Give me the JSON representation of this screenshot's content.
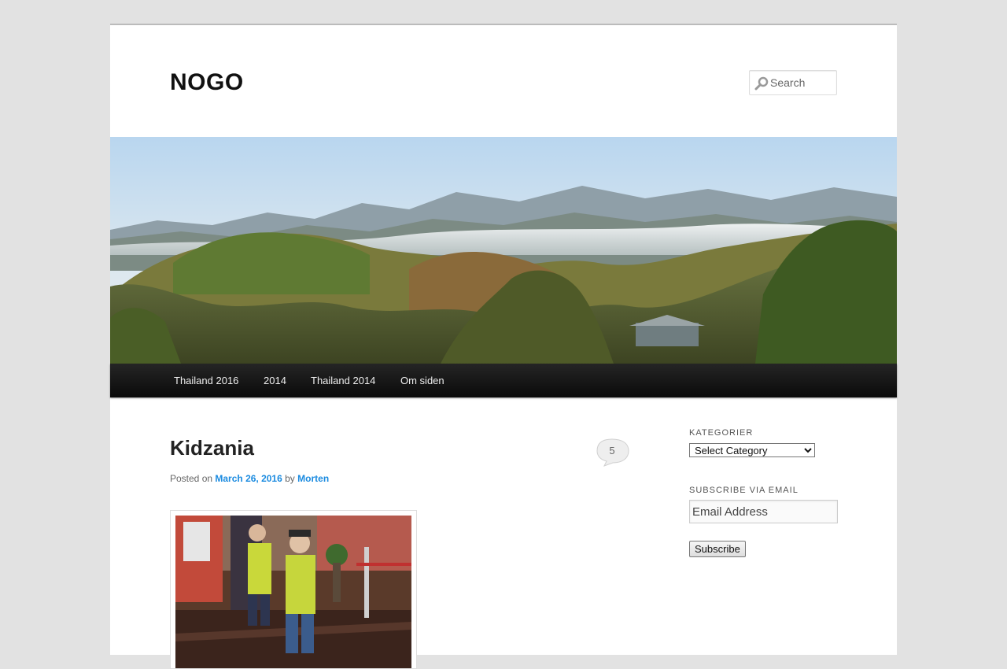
{
  "site": {
    "title": "NOGO"
  },
  "search": {
    "placeholder": "Search",
    "icon": "magnifier"
  },
  "header_image": {
    "alt": "Misty mountains landscape"
  },
  "nav": {
    "items": [
      {
        "label": "Thailand 2016"
      },
      {
        "label": "2014"
      },
      {
        "label": "Thailand 2014"
      },
      {
        "label": "Om siden"
      }
    ]
  },
  "post": {
    "title": "Kidzania",
    "posted_on_label": "Posted on",
    "date": "March 26, 2016",
    "by_label": "by",
    "author": "Morten",
    "comments_count": "5"
  },
  "sidebar": {
    "categories": {
      "title": "KATEGORIER",
      "selected": "Select Category"
    },
    "subscribe": {
      "title": "SUBSCRIBE VIA EMAIL",
      "email_placeholder": "Email Address",
      "button_label": "Subscribe"
    }
  },
  "colors": {
    "link": "#1b8be0",
    "nav_bg": "#111111",
    "page_bg": "#e2e2e2"
  }
}
